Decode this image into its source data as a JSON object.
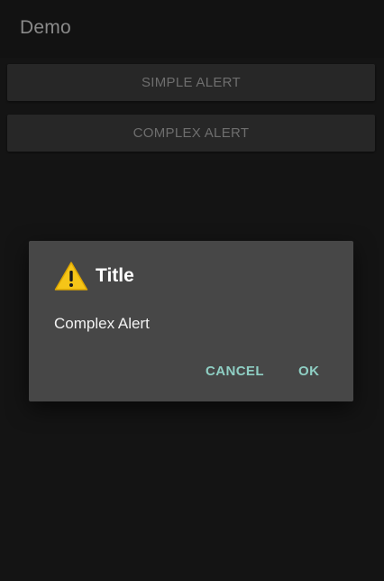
{
  "app_bar": {
    "title": "Demo"
  },
  "actions": {
    "simple_alert_label": "SIMPLE ALERT",
    "complex_alert_label": "COMPLEX ALERT"
  },
  "dialog": {
    "icon": "warning-icon",
    "title": "Title",
    "message": "Complex Alert",
    "cancel_label": "CANCEL",
    "ok_label": "OK"
  },
  "colors": {
    "accent": "#8fcfc4",
    "dialog_background": "#474747",
    "warning_fill": "#f5c518"
  }
}
